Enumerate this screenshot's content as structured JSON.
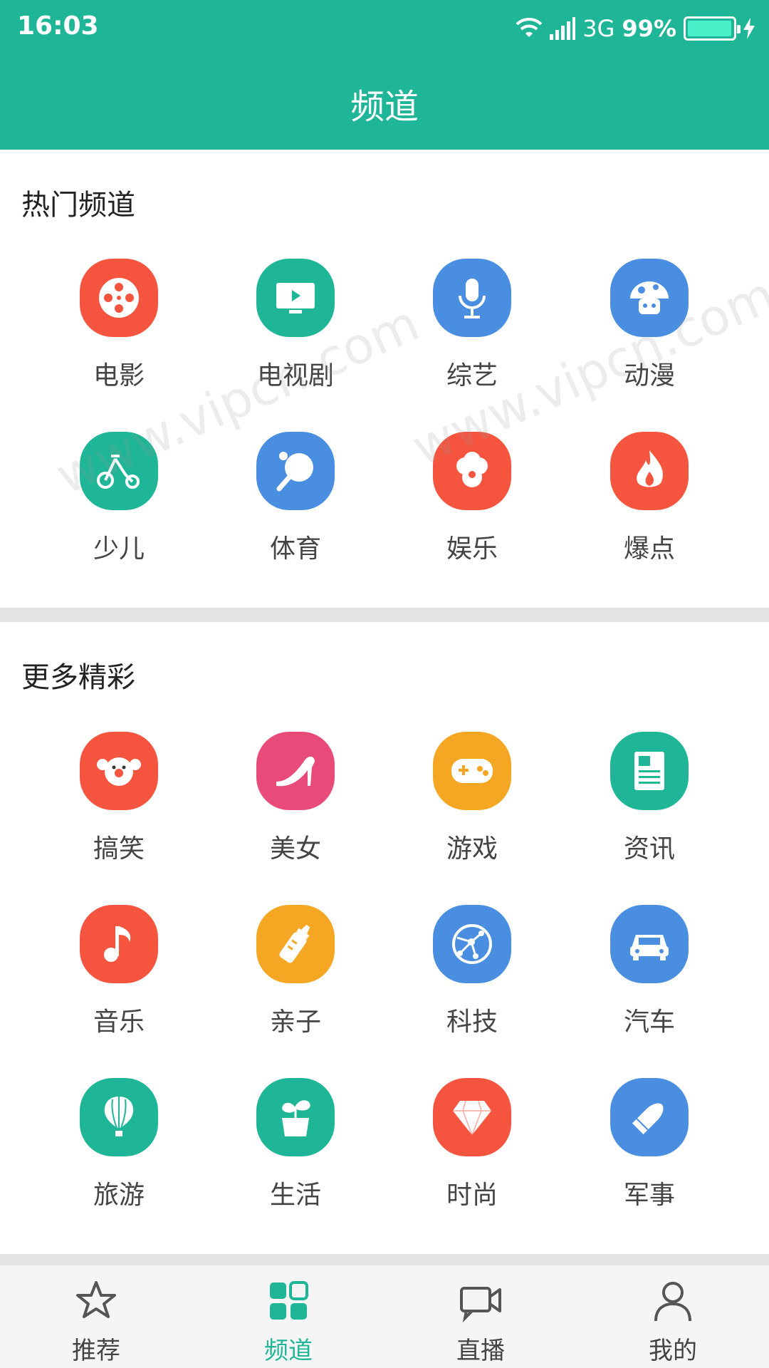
{
  "status_bar": {
    "time": "16:03",
    "network": "3G",
    "battery": "99%",
    "battery_level": 0.99
  },
  "header": {
    "title": "频道"
  },
  "hot_section": {
    "title": "热门频道",
    "items": [
      {
        "label": "电影",
        "icon": "film-reel-icon",
        "color": "#f5553f"
      },
      {
        "label": "电视剧",
        "icon": "tv-icon",
        "color": "#1fb697"
      },
      {
        "label": "综艺",
        "icon": "microphone-icon",
        "color": "#4a8ee2"
      },
      {
        "label": "动漫",
        "icon": "mushroom-icon",
        "color": "#4a8ee2"
      },
      {
        "label": "少儿",
        "icon": "tricycle-icon",
        "color": "#1fb697"
      },
      {
        "label": "体育",
        "icon": "ping-pong-icon",
        "color": "#4a8ee2"
      },
      {
        "label": "娱乐",
        "icon": "flower-icon",
        "color": "#f5553f"
      },
      {
        "label": "爆点",
        "icon": "flame-icon",
        "color": "#f5553f"
      }
    ]
  },
  "more_section": {
    "title": "更多精彩",
    "items": [
      {
        "label": "搞笑",
        "icon": "clown-icon",
        "color": "#f5553f"
      },
      {
        "label": "美女",
        "icon": "high-heel-icon",
        "color": "#e84b7a"
      },
      {
        "label": "游戏",
        "icon": "gamepad-icon",
        "color": "#f5a623"
      },
      {
        "label": "资讯",
        "icon": "newspaper-icon",
        "color": "#1fb697"
      },
      {
        "label": "音乐",
        "icon": "music-note-icon",
        "color": "#f5553f"
      },
      {
        "label": "亲子",
        "icon": "baby-bottle-icon",
        "color": "#f5a623"
      },
      {
        "label": "科技",
        "icon": "network-globe-icon",
        "color": "#4a8ee2"
      },
      {
        "label": "汽车",
        "icon": "car-icon",
        "color": "#4a8ee2"
      },
      {
        "label": "旅游",
        "icon": "hot-air-balloon-icon",
        "color": "#1fb697"
      },
      {
        "label": "生活",
        "icon": "plant-pot-icon",
        "color": "#1fb697"
      },
      {
        "label": "时尚",
        "icon": "diamond-icon",
        "color": "#f5553f"
      },
      {
        "label": "军事",
        "icon": "bullet-icon",
        "color": "#4a8ee2"
      }
    ]
  },
  "bottom_nav": {
    "items": [
      {
        "label": "推荐",
        "icon": "star-icon",
        "active": false
      },
      {
        "label": "频道",
        "icon": "grid-icon",
        "active": true
      },
      {
        "label": "直播",
        "icon": "video-camera-icon",
        "active": false
      },
      {
        "label": "我的",
        "icon": "user-icon",
        "active": false
      }
    ]
  },
  "watermark": "www.vipcn.com"
}
